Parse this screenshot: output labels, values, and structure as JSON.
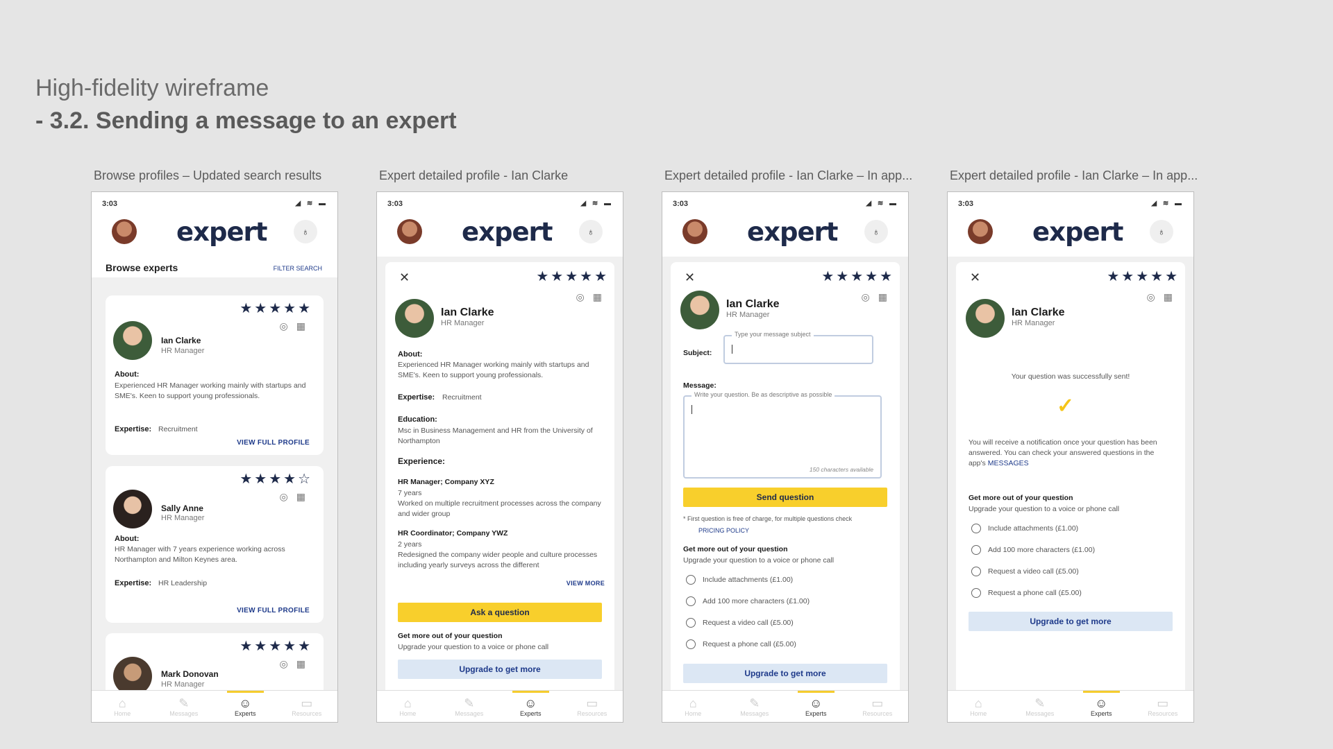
{
  "header": {
    "subtitle": "High-fidelity wireframe",
    "title": "- 3.2. Sending a message to an expert"
  },
  "common": {
    "time": "3:03",
    "logo": "expert",
    "stars": "★★★★★",
    "stars_half": "★★★★☆",
    "nav": [
      {
        "label": "Home"
      },
      {
        "label": "Messages"
      },
      {
        "label": "Experts"
      },
      {
        "label": "Resources"
      }
    ]
  },
  "screens": [
    {
      "caption": "Browse profiles – Updated search results",
      "heading": "Browse experts",
      "filter": "FILTER SEARCH",
      "experts": [
        {
          "name": "Ian Clarke",
          "role": "HR Manager",
          "about_label": "About:",
          "about": "Experienced HR Manager working mainly with startups and SME's. Keen to support young professionals.",
          "expertise_label": "Expertise:",
          "expertise": "Recruitment",
          "link": "VIEW FULL PROFILE"
        },
        {
          "name": "Sally Anne",
          "role": "HR Manager",
          "about_label": "About:",
          "about": "HR Manager with 7 years experience working across Northampton and Milton Keynes area.",
          "expertise_label": "Expertise:",
          "expertise": "HR Leadership",
          "link": "VIEW FULL PROFILE"
        },
        {
          "name": "Mark Donovan",
          "role": "HR Manager"
        }
      ]
    },
    {
      "caption": "Expert detailed profile - Ian Clarke",
      "name": "Ian Clarke",
      "role": "HR Manager",
      "about_label": "About:",
      "about": "Experienced HR Manager working mainly with startups and SME's. Keen to support young professionals.",
      "expertise_label": "Expertise:",
      "expertise": "Recruitment",
      "education_label": "Education:",
      "education": "Msc in Business Management and HR from the University of Northampton",
      "experience_label": "Experience:",
      "job1_title": "HR Manager; Company XYZ",
      "job1_years": "7 years",
      "job1_desc": "Worked on multiple recruitment processes across the company and wider group",
      "job2_title": "HR Coordinator; Company YWZ",
      "job2_years": "2 years",
      "job2_desc": "Redesigned the company wider people and culture processes including yearly surveys across the different",
      "view_more": "VIEW MORE",
      "ask": "Ask a question",
      "more_title": "Get more out of your question",
      "more_sub": "Upgrade your question to a voice or phone call",
      "upgrade": "Upgrade to get more"
    },
    {
      "caption": "Expert detailed profile - Ian Clarke – In app...",
      "name": "Ian Clarke",
      "role": "HR Manager",
      "subject_label": "Subject:",
      "subject_placeholder": "Type your message subject",
      "message_label": "Message:",
      "message_placeholder": "Write your question. Be as descriptive as possible",
      "chars": "150 characters available",
      "send": "Send question",
      "note": "* First question is free of charge, for multiple questions check",
      "pricing": "PRICING POLICY",
      "more_title": "Get more out of your question",
      "more_sub": "Upgrade your question to a voice or phone call",
      "options": [
        "Include attachments (£1.00)",
        "Add 100 more characters (£1.00)",
        "Request a video call (£5.00)",
        "Request a phone call (£5.00)"
      ],
      "upgrade": "Upgrade to get more"
    },
    {
      "caption": "Expert detailed profile - Ian Clarke – In app...",
      "name": "Ian Clarke",
      "role": "HR Manager",
      "success": "Your question was successfully sent!",
      "check": "✓",
      "info": "You will receive a notification once your question has been answered. You can check your answered questions in the app's",
      "messages_link": "MESSAGES",
      "more_title": "Get more out of your question",
      "more_sub": "Upgrade your question to a voice or phone call",
      "options": [
        "Include attachments (£1.00)",
        "Add 100 more characters (£1.00)",
        "Request a video call (£5.00)",
        "Request a phone call (£5.00)"
      ],
      "upgrade": "Upgrade to get more"
    }
  ]
}
